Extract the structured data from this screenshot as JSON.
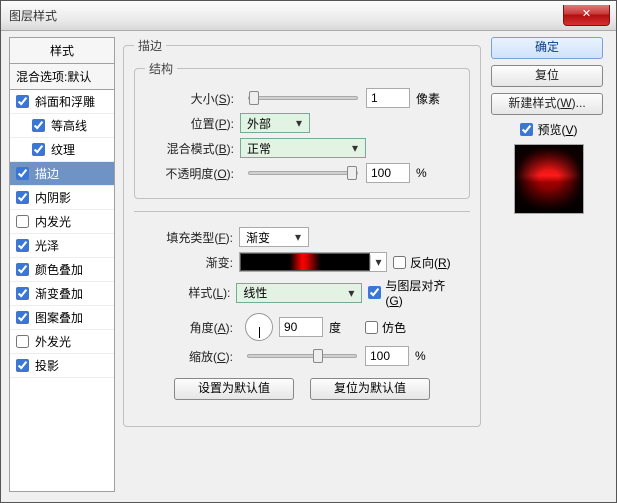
{
  "window": {
    "title": "图层样式",
    "close_glyph": "✕"
  },
  "left": {
    "header": "样式",
    "blend": "混合选项:默认",
    "items": [
      {
        "label": "斜面和浮雕",
        "checked": true,
        "sub": false
      },
      {
        "label": "等高线",
        "checked": true,
        "sub": true
      },
      {
        "label": "纹理",
        "checked": true,
        "sub": true
      },
      {
        "label": "描边",
        "checked": true,
        "sub": false,
        "selected": true
      },
      {
        "label": "内阴影",
        "checked": true,
        "sub": false
      },
      {
        "label": "内发光",
        "checked": false,
        "sub": false
      },
      {
        "label": "光泽",
        "checked": true,
        "sub": false
      },
      {
        "label": "颜色叠加",
        "checked": true,
        "sub": false
      },
      {
        "label": "渐变叠加",
        "checked": true,
        "sub": false
      },
      {
        "label": "图案叠加",
        "checked": true,
        "sub": false
      },
      {
        "label": "外发光",
        "checked": false,
        "sub": false
      },
      {
        "label": "投影",
        "checked": true,
        "sub": false
      }
    ]
  },
  "main": {
    "legend_outer": "描边",
    "legend_struct": "结构",
    "size": {
      "label_pre": "大小(",
      "hot": "S",
      "label_post": "):",
      "value": "1",
      "unit": "像素"
    },
    "pos": {
      "label_pre": "位置(",
      "hot": "P",
      "label_post": "):",
      "value": "外部"
    },
    "blend": {
      "label_pre": "混合模式(",
      "hot": "B",
      "label_post": "):",
      "value": "正常"
    },
    "opac": {
      "label_pre": "不透明度(",
      "hot": "O",
      "label_post": "):",
      "value": "100",
      "unit": "%"
    },
    "fill": {
      "label_pre": "填充类型(",
      "hot": "F",
      "label_post": "):",
      "value": "渐变"
    },
    "grad": {
      "label": "渐变:",
      "reverse_pre": "反向(",
      "reverse_hot": "R",
      "reverse_post": ")",
      "reverse_checked": false
    },
    "style": {
      "label_pre": "样式(",
      "hot": "L",
      "label_post": "):",
      "value": "线性",
      "align_pre": "与图层对齐(",
      "align_hot": "G",
      "align_post": ")",
      "align_checked": true
    },
    "angle": {
      "label_pre": "角度(",
      "hot": "A",
      "label_post": "):",
      "value": "90",
      "unit": "度",
      "dither": "仿色",
      "dither_checked": false
    },
    "scale": {
      "label_pre": "缩放(",
      "hot": "C",
      "label_post": "):",
      "value": "100",
      "unit": "%"
    },
    "btn_default": "设置为默认值",
    "btn_reset": "复位为默认值"
  },
  "right": {
    "ok": "确定",
    "reset": "复位",
    "newstyle_pre": "新建样式(",
    "newstyle_hot": "W",
    "newstyle_post": ")...",
    "preview_pre": "预览(",
    "preview_hot": "V",
    "preview_post": ")",
    "preview_checked": true
  }
}
